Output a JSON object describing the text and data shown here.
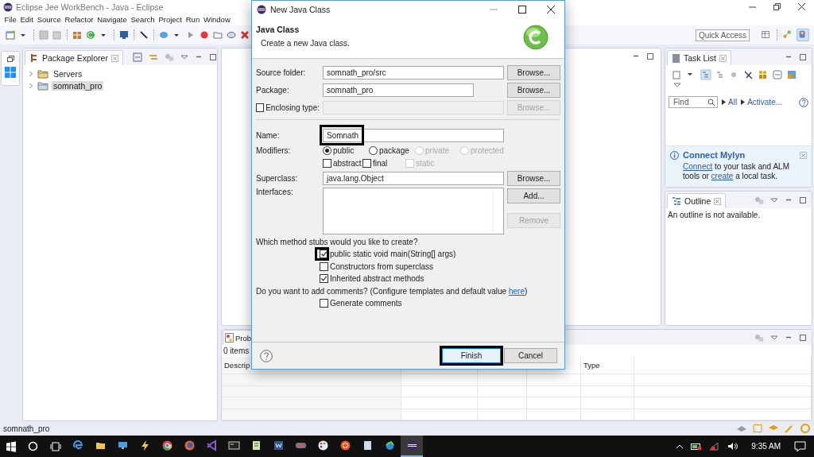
{
  "window": {
    "title": "Eclipse Jee WorkBench - Java - Eclipse"
  },
  "menu": [
    "File",
    "Edit",
    "Source",
    "Refactor",
    "Navigate",
    "Search",
    "Project",
    "Run",
    "Window"
  ],
  "quick_access": {
    "placeholder": "Quick Access"
  },
  "perspectives": [
    {
      "kind": "open",
      "selected": false
    },
    {
      "kind": "javaee",
      "selected": false
    },
    {
      "kind": "java",
      "selected": true
    }
  ],
  "package_explorer": {
    "title": "Package Explorer",
    "items": [
      {
        "label": "Servers",
        "expanded": false,
        "selected": false
      },
      {
        "label": "somnath_pro",
        "expanded": false,
        "selected": true
      }
    ]
  },
  "task_list": {
    "title": "Task List",
    "find": {
      "placeholder": "Find"
    },
    "filters": [
      "All",
      "Activate..."
    ]
  },
  "mylyn": {
    "title": "Connect Mylyn",
    "message": [
      {
        "kind": "link",
        "text": "Connect"
      },
      {
        "kind": "text",
        "text": " to your task and ALM tools or "
      },
      {
        "kind": "link",
        "text": "create"
      },
      {
        "kind": "text",
        "text": " a local task."
      }
    ]
  },
  "outline": {
    "title": "Outline",
    "message": "An outline is not available."
  },
  "problems": {
    "title": "Prob",
    "count": "0 items",
    "columns": [
      "Descrip",
      "Type"
    ]
  },
  "status_bar": {
    "text": "somnath_pro"
  },
  "taskbar": {
    "time": "9:35 AM",
    "apps": [
      {
        "kind": "edge",
        "selected": false
      },
      {
        "kind": "folder",
        "selected": false
      },
      {
        "kind": "monitor",
        "selected": false
      },
      {
        "kind": "tools",
        "selected": false
      },
      {
        "kind": "chrome",
        "selected": false
      },
      {
        "kind": "firefox",
        "selected": false
      },
      {
        "kind": "studio",
        "selected": false
      },
      {
        "kind": "console",
        "selected": false
      },
      {
        "kind": "notepad",
        "selected": false
      },
      {
        "kind": "word",
        "selected": false
      },
      {
        "kind": "media",
        "selected": false
      },
      {
        "kind": "paint",
        "selected": false
      },
      {
        "kind": "ubuntu",
        "selected": false
      },
      {
        "kind": "document",
        "selected": false
      },
      {
        "kind": "network",
        "selected": false
      },
      {
        "kind": "eclipse",
        "selected": true
      }
    ]
  },
  "dialog": {
    "title": "New Java Class",
    "heading": "Java Class",
    "description": "Create a new Java class.",
    "source_folder": {
      "label": "Source folder:",
      "value": "somnath_pro/src",
      "button": {
        "label": "Browse...",
        "disabled": false
      }
    },
    "package": {
      "label": "Package:",
      "value": "somnath_pro",
      "button": {
        "label": "Browse...",
        "disabled": false
      }
    },
    "enclosing_type": {
      "label": "Enclosing type:",
      "checked": false,
      "disabled": true,
      "button": {
        "label": "Browse...",
        "disabled": true
      }
    },
    "name": {
      "label": "Name:",
      "value": "Somnath",
      "highlighted": true
    },
    "modifiers": {
      "label": "Modifiers:",
      "visibility": [
        {
          "label": "public",
          "selected": true,
          "disabled": false
        },
        {
          "label": "package",
          "selected": false,
          "disabled": false
        },
        {
          "label": "private",
          "selected": false,
          "disabled": true
        },
        {
          "label": "protected",
          "selected": false,
          "disabled": true
        }
      ],
      "flags": [
        {
          "label": "abstract",
          "checked": false,
          "disabled": false
        },
        {
          "label": "final",
          "checked": false,
          "disabled": false
        },
        {
          "label": "static",
          "checked": false,
          "disabled": true
        }
      ]
    },
    "superclass": {
      "label": "Superclass:",
      "value": "java.lang.Object",
      "button": {
        "label": "Browse...",
        "disabled": false
      }
    },
    "interfaces": {
      "label": "Interfaces:",
      "buttons": [
        {
          "label": "Add...",
          "disabled": false
        },
        {
          "label": "Remove",
          "disabled": true
        }
      ]
    },
    "stubs": {
      "question": "Which method stubs would you like to create?",
      "options": [
        {
          "label": "public static void main(String[] args)",
          "checked": true,
          "highlighted": true
        },
        {
          "label": "Constructors from superclass",
          "checked": false,
          "highlighted": false
        },
        {
          "label": "Inherited abstract methods",
          "checked": true,
          "highlighted": false
        }
      ]
    },
    "comments": {
      "question": "Do you want to add comments? (Configure templates and default value ",
      "link": "here",
      "question_end": ")",
      "option": {
        "label": "Generate comments",
        "checked": false
      }
    },
    "buttons": [
      {
        "label": "Finish",
        "default": true,
        "highlighted": true
      },
      {
        "label": "Cancel",
        "default": false,
        "highlighted": false
      }
    ]
  }
}
